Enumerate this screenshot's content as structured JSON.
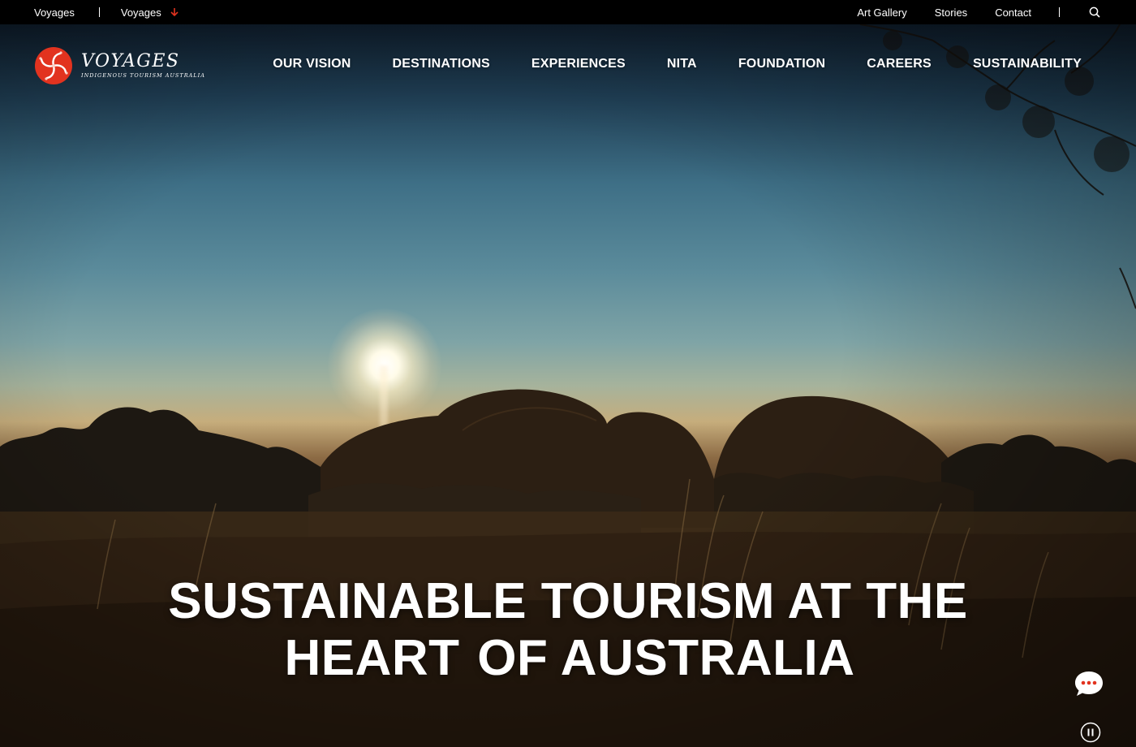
{
  "topbar": {
    "left_links": [
      {
        "label": "Voyages"
      },
      {
        "label": "Voyages",
        "icon": "arrow-down-icon"
      }
    ],
    "right_links": [
      {
        "label": "Art Gallery"
      },
      {
        "label": "Stories"
      },
      {
        "label": "Contact"
      }
    ],
    "search_icon": "search-icon"
  },
  "brand": {
    "name": "VOYAGES",
    "tagline": "INDIGENOUS TOURISM AUSTRALIA",
    "color": "#e2331f"
  },
  "nav": {
    "items": [
      {
        "label": "OUR VISION"
      },
      {
        "label": "DESTINATIONS"
      },
      {
        "label": "EXPERIENCES"
      },
      {
        "label": "NITA"
      },
      {
        "label": "FOUNDATION"
      },
      {
        "label": "CAREERS"
      },
      {
        "label": "SUSTAINABILITY"
      }
    ]
  },
  "hero": {
    "headline_line1": "SUSTAINABLE TOURISM AT THE",
    "headline_highlight": "HEART",
    "headline_line2_rest": "OF AUSTRALIA",
    "highlight_color": "#e2331f"
  },
  "controls": {
    "chat_icon": "chat-bubble-icon",
    "pause_icon": "pause-icon"
  }
}
